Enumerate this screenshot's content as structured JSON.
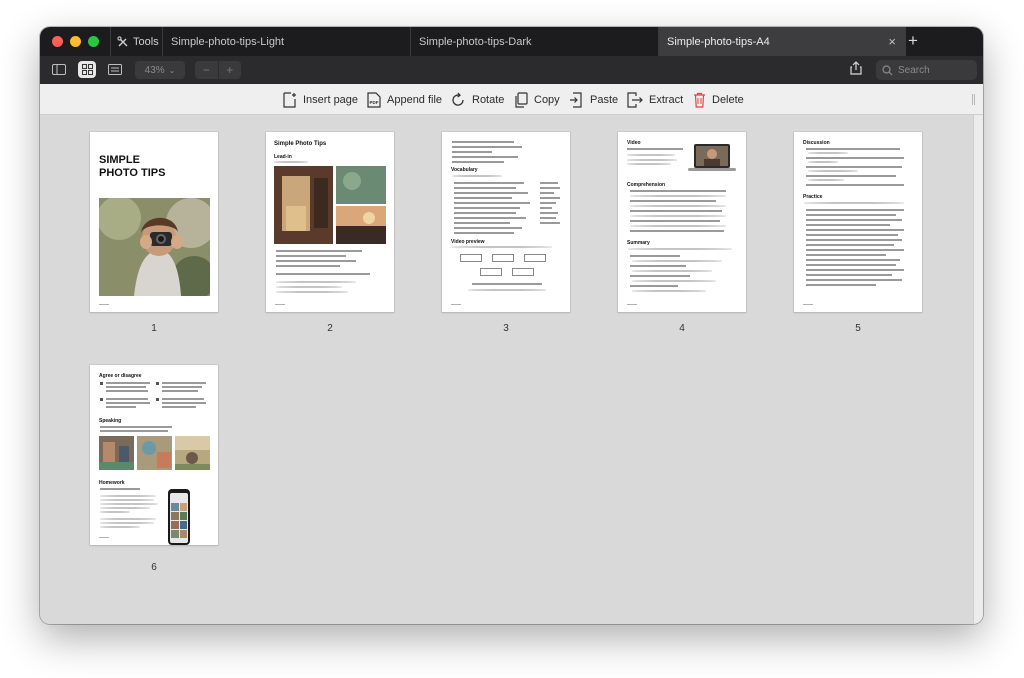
{
  "window": {
    "tools_label": "Tools",
    "tabs": [
      {
        "label": "Simple-photo-tips-Light",
        "active": false
      },
      {
        "label": "Simple-photo-tips-Dark",
        "active": false
      },
      {
        "label": "Simple-photo-tips-A4",
        "active": true
      }
    ],
    "close_glyph": "×",
    "add_tab_glyph": "+"
  },
  "view_toolbar": {
    "zoom": "43%",
    "zoom_out": "−",
    "zoom_in": "+",
    "search_placeholder": "Search",
    "selected_view": "grid"
  },
  "actions": {
    "insert_page": "Insert page",
    "append_file": "Append file",
    "rotate": "Rotate",
    "copy": "Copy",
    "paste": "Paste",
    "extract": "Extract",
    "delete": "Delete"
  },
  "pages": [
    {
      "number": "1",
      "title": "SIMPLE\nPHOTO TIPS"
    },
    {
      "number": "2",
      "title": "Simple Photo Tips",
      "subtitle": "Lead-in"
    },
    {
      "number": "3",
      "title": "Vocabulary",
      "subtitle": "Video preview"
    },
    {
      "number": "4",
      "title": "Video",
      "subtitle": "Comprehension",
      "subtitle2": "Summary"
    },
    {
      "number": "5",
      "title": "Discussion",
      "subtitle": "Practice"
    },
    {
      "number": "6",
      "title": "Agree or disagree",
      "subtitle": "Speaking",
      "subtitle2": "Homework"
    }
  ],
  "colors": {
    "accent_delete": "#e0443e",
    "traffic_red": "#ff5f57",
    "traffic_yellow": "#febc2e",
    "traffic_green": "#28c840"
  }
}
